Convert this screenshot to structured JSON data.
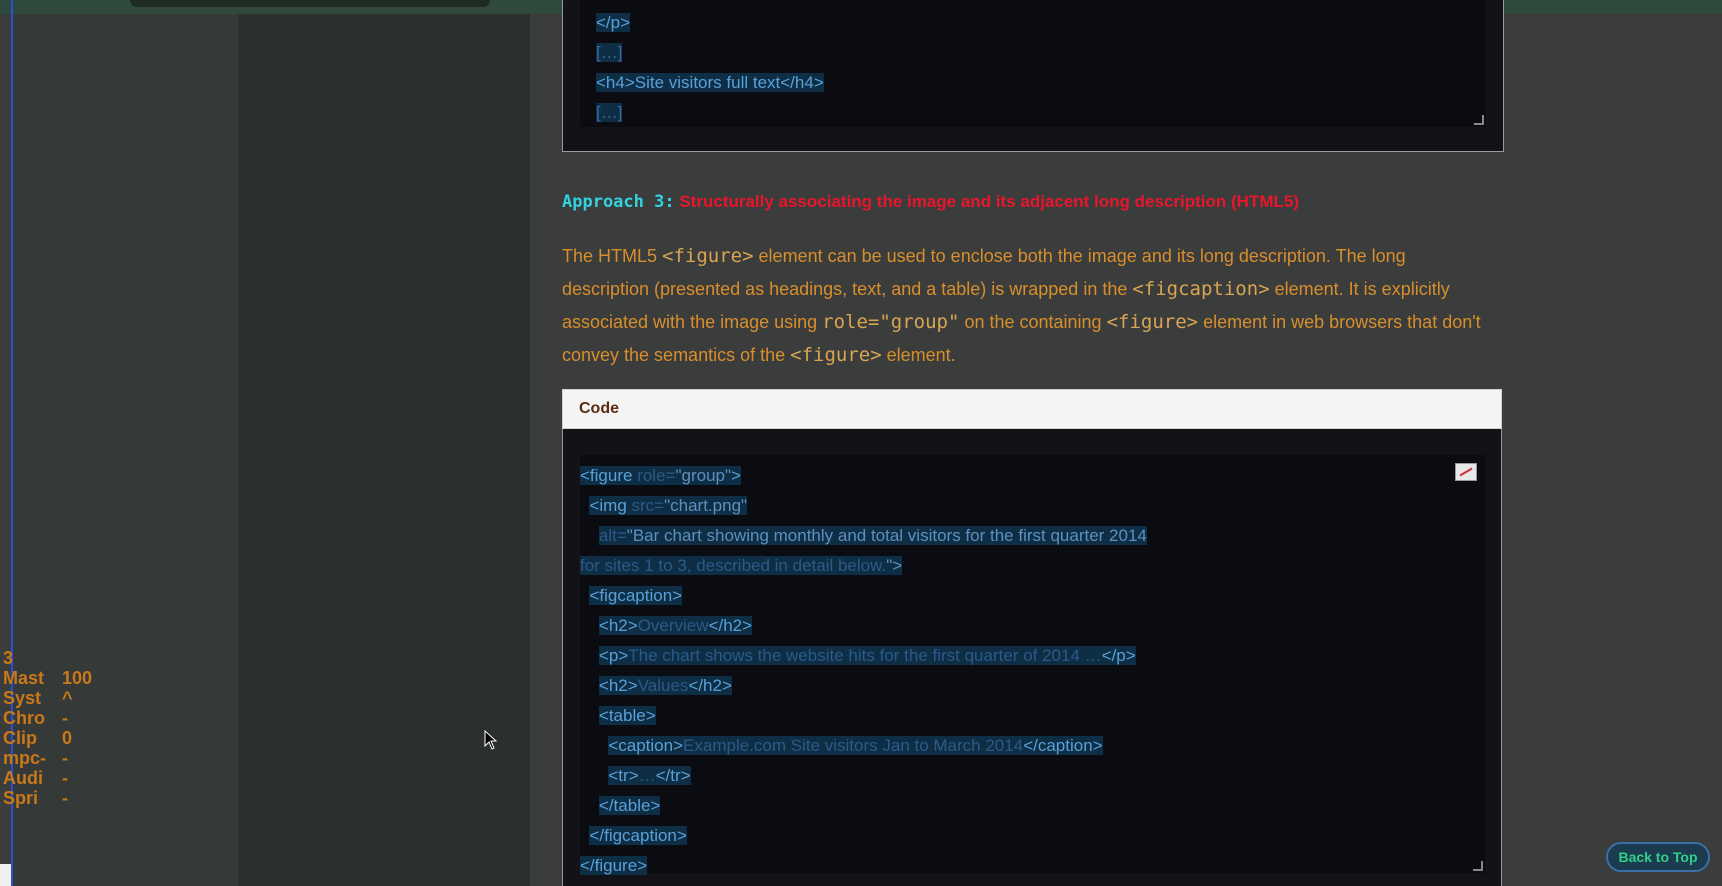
{
  "overlay": {
    "rows": [
      {
        "name": "3",
        "value": ""
      },
      {
        "name": "Mast",
        "value": "100"
      },
      {
        "name": "Syst",
        "value": "^"
      },
      {
        "name": "Chro",
        "value": "-"
      },
      {
        "name": "Clip",
        "value": "0"
      },
      {
        "name": "mpc-",
        "value": "-"
      },
      {
        "name": "Audi",
        "value": "-"
      },
      {
        "name": "Spri",
        "value": "-"
      }
    ]
  },
  "code_top": {
    "lines": [
      "</p>",
      "[…]",
      "<h4>Site visitors full text</h4>",
      "[…]"
    ]
  },
  "approach3": {
    "tag": "Approach 3:",
    "title": "Structurally associating the image and its adjacent long description (HTML5)"
  },
  "paragraph": {
    "p1": "The HTML5 ",
    "c1": "<figure>",
    "p2": " element can be used to enclose both the image and its long description. The long description (presented as headings, text, and a table) is wrapped in the ",
    "c2": "<figcaption>",
    "p3": " element. It is explicitly associated with the image using ",
    "c3": "role=\"group\"",
    "p4": " on the containing ",
    "c4": "<figure>",
    "p5": " element in web browsers that don't convey the semantics of the ",
    "c5": "<figure>",
    "p6": " element."
  },
  "code_section": {
    "label": "Code",
    "lines": [
      "<figure role=\"group\">",
      "  <img src=\"chart.png\"",
      "    alt=\"Bar chart showing monthly and total visitors for the first quarter 2014",
      "for sites 1 to 3, described in detail below.\">",
      "  <figcaption>",
      "    <h2>Overview</h2>",
      "    <p>The chart shows the website hits for the first quarter of 2014 …</p>",
      "    <h2>Values</h2>",
      "    <table>",
      "      <caption>Example.com Site visitors Jan to March 2014</caption>",
      "      <tr>…</tr>",
      "    </table>",
      "  </figcaption>",
      "</figure>"
    ]
  },
  "back_to_top": "Back to Top",
  "colors": {
    "accent_cyan": "#34d2e0",
    "title_red": "#e8152c",
    "para_orange": "#d98e2c",
    "back_green": "#2fd18a"
  }
}
